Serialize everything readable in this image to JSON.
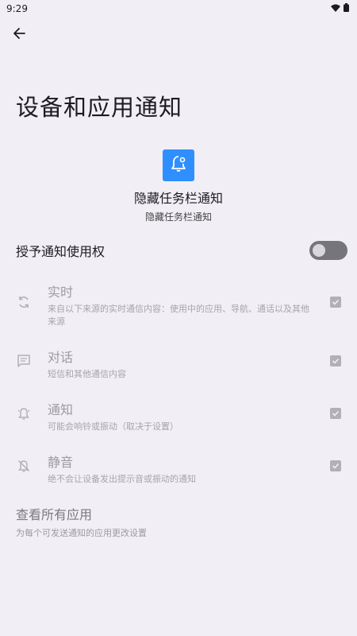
{
  "status_bar": {
    "time": "9:29",
    "icons": [
      "wifi-icon",
      "battery-icon"
    ]
  },
  "nav": {
    "back_icon": "arrow-left-icon"
  },
  "page": {
    "title": "设备和应用通知"
  },
  "app": {
    "icon": "bell-settings-icon",
    "icon_color": "#2f8fff",
    "name": "隐藏任务栏通知",
    "subtitle": "隐藏任务栏通知"
  },
  "grant": {
    "label": "授予通知使用权",
    "enabled": false
  },
  "notification_types": [
    {
      "icon": "sync-icon",
      "title": "实时",
      "description": "来自以下来源的实时通信内容：使用中的应用、导航、通话以及其他来源",
      "checked": true
    },
    {
      "icon": "message-icon",
      "title": "对话",
      "description": "短信和其他通信内容",
      "checked": true
    },
    {
      "icon": "ringing-bell-icon",
      "title": "通知",
      "description": "可能会响铃或振动（取决于设置）",
      "checked": true
    },
    {
      "icon": "muted-bell-icon",
      "title": "静音",
      "description": "绝不会让设备发出提示音或振动的通知",
      "checked": true
    }
  ],
  "view_all": {
    "title": "查看所有应用",
    "description": "为每个可发送通知的应用更改设置"
  }
}
